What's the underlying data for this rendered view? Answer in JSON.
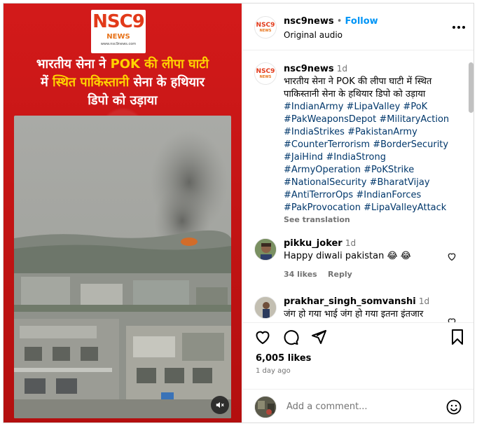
{
  "media": {
    "logo": {
      "main": "NSC9",
      "sub": "NEWS",
      "url": "www.nsc9news.com"
    },
    "headline": {
      "line1_pre": "भारतीय सेना ने ",
      "line1_hl": "POK की लीपा घाटी",
      "line2_pre": "में ",
      "line2_hl": "स्थित पाकिस्तानी",
      "line2_post": " सेना के हथियार",
      "line3": "डिपो को उड़ाया"
    },
    "mute_icon": "speaker-muted-icon"
  },
  "post": {
    "author": "nsc9news",
    "separator": "•",
    "follow_label": "Follow",
    "audio": "Original audio",
    "more_icon": "more-horizontal-icon"
  },
  "caption": {
    "author": "nsc9news",
    "age": "1d",
    "text": "भारतीय सेना ने POK की लीपा घाटी में स्थित पाकिस्तानी सेना के हथियार डिपो को उड़ाया",
    "hashtags": [
      "#IndianArmy",
      "#LipaValley",
      "#PoK",
      "#PakWeaponsDepot",
      "#MilitaryAction",
      "#IndiaStrikes",
      "#PakistanArmy",
      "#CounterTerrorism",
      "#BorderSecurity",
      "#JaiHind",
      "#IndiaStrong",
      "#ArmyOperation",
      "#PoKStrike",
      "#NationalSecurity",
      "#BharatVijay",
      "#AntiTerrorOps",
      "#IndianForces",
      "#PakProvocation",
      "#LipaValleyAttack"
    ],
    "see_translation": "See translation"
  },
  "comments": [
    {
      "user": "pikku_joker",
      "age": "1d",
      "text": "Happy diwali pakistan 😂 😂",
      "likes": "34 likes",
      "reply": "Reply"
    },
    {
      "user": "prakhar_singh_somvanshi",
      "age": "1d",
      "text": "जंग हो गया भाई जंग हो गया इतना इंतजार"
    }
  ],
  "actions": {
    "likes": "6,005 likes",
    "posted": "1 day ago"
  },
  "add_comment": {
    "placeholder": "Add a comment..."
  }
}
